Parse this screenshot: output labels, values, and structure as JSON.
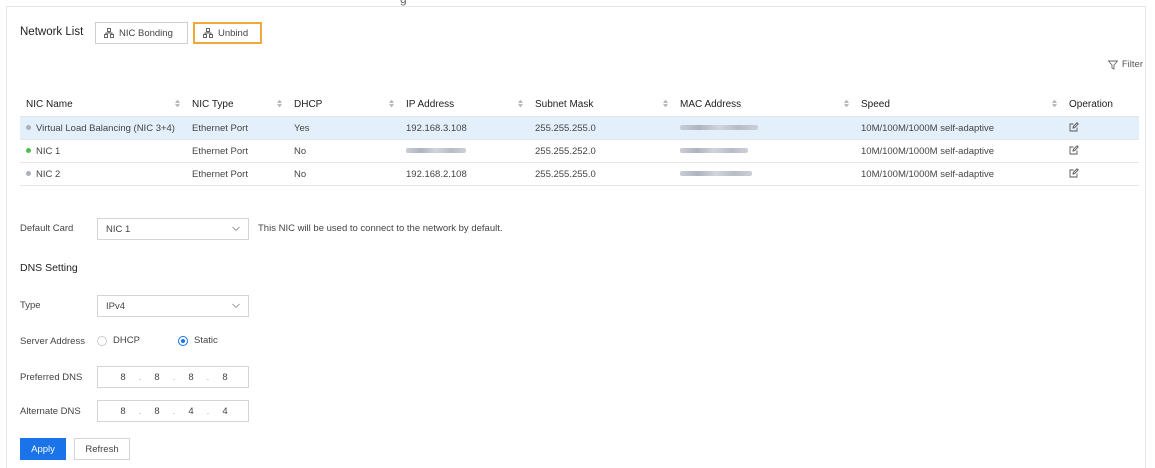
{
  "header": {
    "title": "Network List",
    "nic_bonding_label": "NIC Bonding",
    "unbind_label": "Unbind",
    "filter_label": "Filter"
  },
  "table": {
    "columns": [
      "NIC Name",
      "NIC Type",
      "DHCP",
      "IP Address",
      "Subnet Mask",
      "MAC Address",
      "Speed",
      "Operation"
    ],
    "rows": [
      {
        "name": "Virtual Load Balancing (NIC 3+4)",
        "status_color": "#a9b0b8",
        "type": "Ethernet Port",
        "dhcp": "Yes",
        "ip": "192.168.3.108",
        "mask": "255.255.255.0",
        "speed": "10M/100M/1000M self-adaptive",
        "selected": true
      },
      {
        "name": "NIC 1",
        "status_color": "#4cc04c",
        "type": "Ethernet Port",
        "dhcp": "No",
        "ip": "",
        "mask": "255.255.252.0",
        "speed": "10M/100M/1000M self-adaptive",
        "selected": false
      },
      {
        "name": "NIC 2",
        "status_color": "#a9b0b8",
        "type": "Ethernet Port",
        "dhcp": "No",
        "ip": "192.168.2.108",
        "mask": "255.255.255.0",
        "speed": "10M/100M/1000M self-adaptive",
        "selected": false
      }
    ]
  },
  "default_card": {
    "label": "Default Card",
    "value": "NIC 1",
    "hint": "This NIC will be used to connect to the network by default."
  },
  "dns": {
    "section_title": "DNS Setting",
    "type_label": "Type",
    "type_value": "IPv4",
    "server_address_label": "Server Address",
    "dhcp_option": "DHCP",
    "static_option": "Static",
    "preferred_label": "Preferred DNS",
    "preferred": [
      "8",
      "8",
      "8",
      "8"
    ],
    "alternate_label": "Alternate DNS",
    "alternate": [
      "8",
      "8",
      "4",
      "4"
    ]
  },
  "buttons": {
    "apply": "Apply",
    "refresh": "Refresh"
  },
  "colors": {
    "accent": "#1a73e8",
    "highlight_border": "#f0a838",
    "selected_row": "#e3f0fb"
  }
}
